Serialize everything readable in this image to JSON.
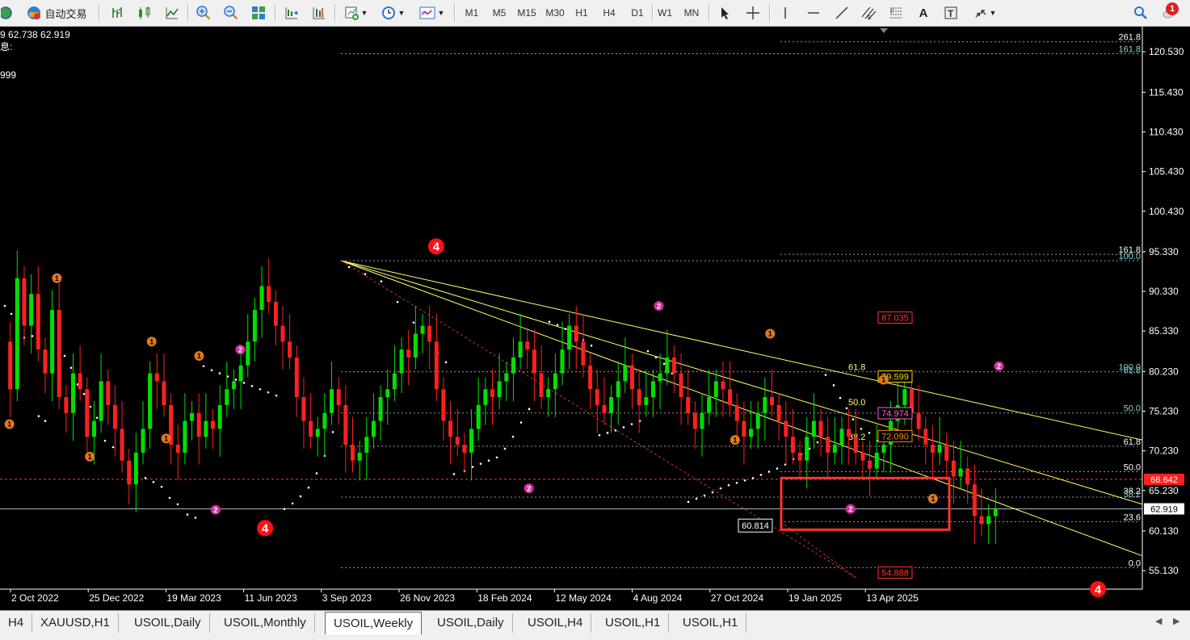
{
  "toolbar": {
    "auto_trade_label": "自动交易",
    "timeframes": [
      "M1",
      "M5",
      "M15",
      "M30",
      "H1",
      "H4",
      "D1",
      "W1",
      "MN"
    ],
    "notification_count": "1"
  },
  "info": {
    "ohlc_line": "9 62.738 62.919",
    "line2": "息:",
    "line3": "999"
  },
  "colors": {
    "background": "#000000",
    "bull_candle": "#00e000",
    "bear_candle": "#ff0000",
    "fib_line": "#808080",
    "trend_line": "#ffff66",
    "highlight_box": "#ff3333"
  },
  "chart_data": {
    "type": "candlestick",
    "symbol": "USOIL",
    "timeframe": "Weekly",
    "ylim": [
      53.0,
      123.5
    ],
    "y_ticks": [
      "120.530",
      "115.430",
      "110.430",
      "105.430",
      "100.430",
      "95.330",
      "90.330",
      "85.330",
      "80.230",
      "75.230",
      "70.230",
      "65.230",
      "60.130",
      "55.130"
    ],
    "x_ticks": [
      "2 Oct 2022",
      "25 Dec 2022",
      "19 Mar 2023",
      "11 Jun 2023",
      "3 Sep 2023",
      "26 Nov 2023",
      "18 Feb 2024",
      "12 May 2024",
      "4 Aug 2024",
      "27 Oct 2024",
      "19 Jan 2025",
      "13 Apr 2025"
    ],
    "current_price": "62.919",
    "current_price_value": 62.919,
    "red_level_label": "66.642",
    "red_level_value": 66.642,
    "boxed_low_label": "60.814",
    "boxed_low_value": 60.814,
    "fib_left_labels": [
      {
        "text": "261.8",
        "value": 121.8
      },
      {
        "text": "161.8",
        "value": 120.3
      },
      {
        "text": "161.8",
        "value": 95.0
      },
      {
        "text": "100.0",
        "value": 94.2
      },
      {
        "text": "100.0",
        "value": 80.2
      },
      {
        "text": "61.8",
        "value": 79.8
      },
      {
        "text": "50.0",
        "value": 75.0
      },
      {
        "text": "61.8",
        "value": 70.8
      },
      {
        "text": "50.0",
        "value": 67.6
      },
      {
        "text": "38.2",
        "value": 64.6
      },
      {
        "text": "38.2",
        "value": 64.2
      },
      {
        "text": "23.6",
        "value": 61.3
      },
      {
        "text": "0.0",
        "value": 55.5
      }
    ],
    "fib_mid_labels": [
      {
        "text": "61.8",
        "value": 80.0
      },
      {
        "text": "50.0",
        "value": 75.6
      },
      {
        "text": "38.2",
        "value": 71.2
      }
    ],
    "projection_boxes": [
      {
        "text": "87.035",
        "value": 87.035,
        "color": "#ff3333"
      },
      {
        "text": "79.599",
        "value": 79.599,
        "color": "#ffd700"
      },
      {
        "text": "74.974",
        "value": 74.974,
        "color": "#ff66cc"
      },
      {
        "text": "72.090",
        "value": 72.09,
        "color": "#ff8800"
      },
      {
        "text": "54.888",
        "value": 54.888,
        "color": "#ff3333"
      }
    ],
    "wave_labels": [
      {
        "text": "1",
        "kind": "orange",
        "t": 0.3,
        "v": 73.6
      },
      {
        "text": "1",
        "kind": "orange",
        "t": 2.6,
        "v": 92.0
      },
      {
        "text": "1",
        "kind": "orange",
        "t": 4.2,
        "v": 69.5
      },
      {
        "text": "1",
        "kind": "orange",
        "t": 7.2,
        "v": 84.0
      },
      {
        "text": "1",
        "kind": "orange",
        "t": 7.9,
        "v": 71.8
      },
      {
        "text": "1",
        "kind": "orange",
        "t": 9.5,
        "v": 82.2
      },
      {
        "text": "2",
        "kind": "magenta",
        "t": 11.5,
        "v": 83.0
      },
      {
        "text": "2",
        "kind": "magenta",
        "t": 10.3,
        "v": 62.8
      },
      {
        "text": "4",
        "kind": "red",
        "t": 12.7,
        "v": 60.5
      },
      {
        "text": "4",
        "kind": "red",
        "t": 21.0,
        "v": 96.0
      },
      {
        "text": "2",
        "kind": "magenta",
        "t": 25.5,
        "v": 65.5
      },
      {
        "text": "2",
        "kind": "magenta",
        "t": 31.8,
        "v": 88.5
      },
      {
        "text": "1",
        "kind": "orange",
        "t": 35.5,
        "v": 71.6
      },
      {
        "text": "1",
        "kind": "orange",
        "t": 37.2,
        "v": 85.0
      },
      {
        "text": "1",
        "kind": "orange",
        "t": 42.7,
        "v": 79.2
      },
      {
        "text": "2",
        "kind": "magenta",
        "t": 41.1,
        "v": 62.9
      },
      {
        "text": "1",
        "kind": "orange",
        "t": 45.1,
        "v": 64.2
      },
      {
        "text": "2",
        "kind": "magenta",
        "t": 48.3,
        "v": 80.9
      },
      {
        "text": "4",
        "kind": "red",
        "t": 53.1,
        "v": 52.8
      }
    ],
    "series_note": "approximate weekly closes, index t = weeks from left edge",
    "closes": [
      84,
      78,
      92,
      86,
      90,
      83,
      80,
      88,
      77,
      75,
      80,
      78,
      72,
      74,
      79,
      76,
      73,
      69,
      66,
      70,
      73,
      80,
      79,
      76,
      71,
      70,
      74,
      75,
      72,
      74,
      73,
      76,
      78,
      79,
      81,
      84,
      88,
      91,
      89,
      86,
      84,
      82,
      77,
      74,
      72,
      73,
      75,
      78,
      76,
      71,
      69,
      70,
      72,
      74,
      77,
      78,
      80,
      83,
      82,
      85,
      86,
      84,
      78,
      74,
      72,
      71,
      70,
      73,
      76,
      78,
      77,
      79,
      80,
      82,
      84,
      83,
      80,
      77,
      78,
      80,
      83,
      86,
      84,
      81,
      78,
      76,
      75,
      77,
      79,
      81,
      78,
      76,
      77,
      79,
      80,
      82,
      80,
      77,
      75,
      73,
      75,
      77,
      79,
      78,
      76,
      74,
      72,
      73,
      75,
      77,
      76,
      74,
      72,
      70,
      69,
      72,
      74,
      72,
      70,
      71,
      73,
      72,
      70,
      69,
      68,
      70,
      71,
      74,
      76,
      78,
      75,
      73,
      71,
      70,
      71,
      69,
      67,
      68,
      66,
      62,
      61,
      62,
      63
    ]
  }
}
